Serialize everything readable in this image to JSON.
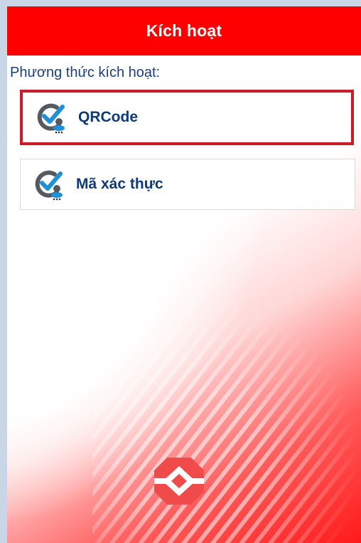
{
  "header": {
    "title": "Kích hoạt",
    "background_color": "#ff0000"
  },
  "section": {
    "label": "Phương thức kích hoạt:"
  },
  "options": [
    {
      "label": "QRCode",
      "icon": "verified-user-icon",
      "selected": true
    },
    {
      "label": "Mã xác thực",
      "icon": "verified-user-icon",
      "selected": false
    }
  ],
  "logo": {
    "icon": "bank-logo-icon",
    "color": "#ef4b4b"
  },
  "colors": {
    "accent": "#ff0000",
    "selected_border": "#c81e2a",
    "option_text": "#0f3a78"
  }
}
